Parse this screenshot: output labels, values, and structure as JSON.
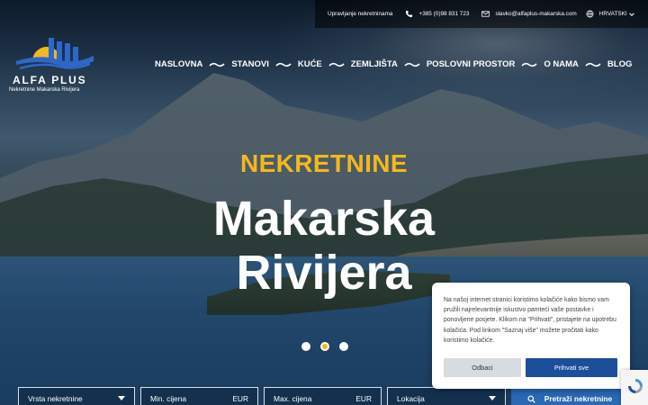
{
  "topbar": {
    "services_label": "Upravljanje nekretninama",
    "phone": "+385 (0)98 831 723",
    "email": "slavko@alfaplus-makarska.com",
    "language": "HRVATSKI"
  },
  "logo": {
    "brand": "ALFA PLUS",
    "tagline": "Nekretnine Makarska Rivijera"
  },
  "nav": {
    "items": [
      "NASLOVNA",
      "STANOVI",
      "KUĆE",
      "ZEMLJIŠTA",
      "POSLOVNI PROSTOR",
      "O NAMA",
      "BLOG"
    ]
  },
  "hero": {
    "eyebrow": "NEKRETNINE",
    "title_line1": "Makarska",
    "title_line2": "Rivijera"
  },
  "slider": {
    "count": 3,
    "active_index": 1
  },
  "search": {
    "type_label": "Vrsta nekretnine",
    "min_price_placeholder": "Min. cijena",
    "max_price_placeholder": "Max. cijena",
    "currency": "EUR",
    "location_label": "Lokacija",
    "submit_label": "Pretraži nekretnine"
  },
  "cookie": {
    "text": "Na našoj internet stranici koristimo kolačiće kako bismo vam pružili najrelevantnije iskustvo pamteći vaše postavke i ponovljene posjete. Klikom na \"Prihvati\", pristajete na upotrebu kolačića. Pod linkom \"Saznaj više\" možete pročitati kako koristimo kolačiće.",
    "decline_label": "Odbaci",
    "accept_label": "Prihvati sve"
  },
  "colors": {
    "accent_gold": "#f2b81e",
    "primary_blue": "#2a69b4",
    "accept_blue": "#1c4e9c"
  },
  "icons": [
    "phone-icon",
    "mail-icon",
    "globe-icon",
    "chevron-down-icon",
    "search-icon",
    "recaptcha-icon"
  ]
}
